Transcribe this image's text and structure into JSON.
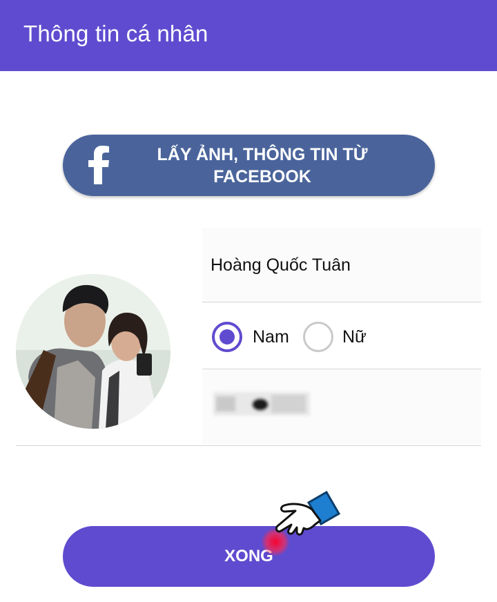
{
  "appbar": {
    "title": "Thông tin cá nhân"
  },
  "facebook_button": {
    "label": "LẤY ẢNH, THÔNG TIN TỪ FACEBOOK",
    "icon": "facebook-icon",
    "color": "#4a649b"
  },
  "profile": {
    "avatar": "profile-photo",
    "name": "Hoàng Quốc Tuân",
    "gender_options": [
      {
        "label": "Nam",
        "selected": true
      },
      {
        "label": "Nữ",
        "selected": false
      }
    ],
    "birthdate": ""
  },
  "done_button": {
    "label": "XONG"
  },
  "colors": {
    "primary": "#5f4bcf",
    "facebook": "#4a649b",
    "divider": "#d5d5d5"
  },
  "overlay": {
    "hand_cursor": "hand-pointer-icon"
  }
}
